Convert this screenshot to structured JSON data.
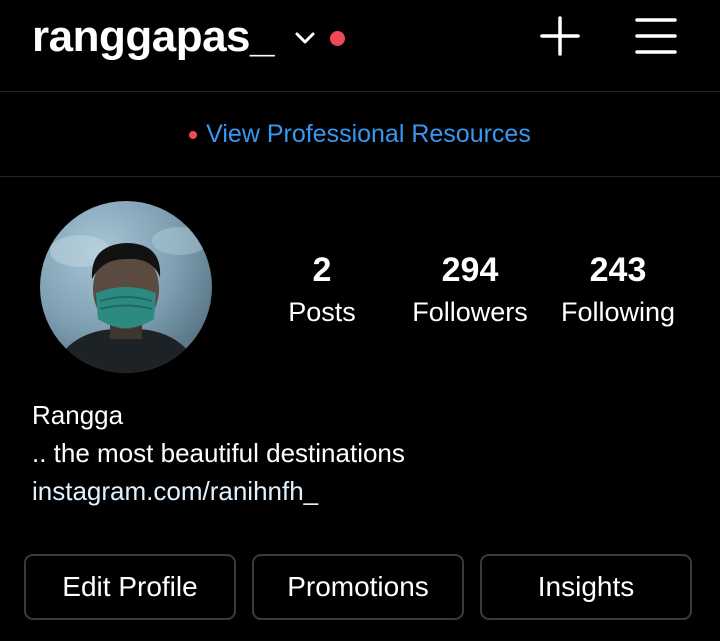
{
  "header": {
    "username": "ranggapas_",
    "icons": [
      "chevron-down-icon",
      "notification-dot",
      "plus-icon",
      "menu-icon"
    ],
    "accent_red": "#ed4956"
  },
  "resources": {
    "label": "View Professional Resources",
    "color": "#3897f0"
  },
  "profile": {
    "stats": [
      {
        "value": "2",
        "label": "Posts"
      },
      {
        "value": "294",
        "label": "Followers"
      },
      {
        "value": "243",
        "label": "Following"
      }
    ],
    "name": "Rangga",
    "bio": ".. the most beautiful destinations",
    "link": "instagram.com/ranihnfh_"
  },
  "actions": {
    "edit_profile": "Edit Profile",
    "promotions": "Promotions",
    "insights": "Insights"
  }
}
